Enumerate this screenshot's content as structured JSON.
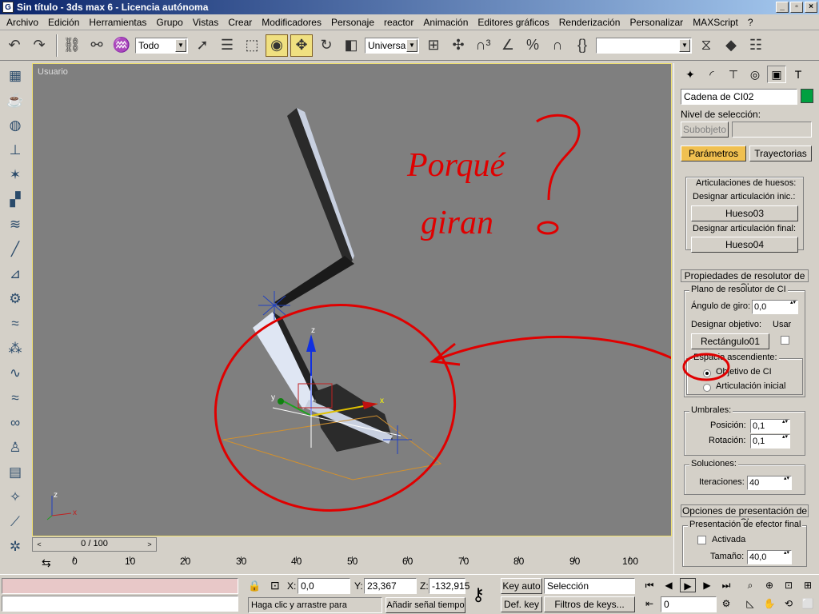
{
  "window": {
    "title": "Sin título - 3ds max 6 - Licencia autónoma",
    "app_icon": "3ds-max-icon"
  },
  "menu": [
    "Archivo",
    "Edición",
    "Herramientas",
    "Grupo",
    "Vistas",
    "Crear",
    "Modificadores",
    "Personaje",
    "reactor",
    "Animación",
    "Editores gráficos",
    "Renderización",
    "Personalizar",
    "MAXScript",
    "?"
  ],
  "toolbar": {
    "selection_filter": "Todo",
    "reference_coord": "Universal",
    "named_selection": ""
  },
  "viewport": {
    "label": "Usuario",
    "annotation_line1": "Porqué",
    "annotation_line2": "giran",
    "annotation_color": "#e00000",
    "axis_z": "z",
    "axis_x": "x",
    "axis_y": "y"
  },
  "timeline": {
    "position": "0 / 100",
    "ticks": [
      "0",
      "10",
      "20",
      "30",
      "40",
      "50",
      "60",
      "70",
      "80",
      "90",
      "100"
    ]
  },
  "panel": {
    "object_name": "Cadena de CI02",
    "object_color": "#00a040",
    "selection_level_label": "Nivel de selección:",
    "subobject_button": "Subobjeto",
    "tab_params": "Parámetros",
    "tab_trajectories": "Trayectorias",
    "bone_joints_group": "Articulaciones de huesos:",
    "assign_start_label": "Designar articulación inic.:",
    "start_bone": "Hueso03",
    "assign_end_label": "Designar articulación final:",
    "end_bone": "Hueso04",
    "ik_solver_props": "Propiedades de resolutor de CI",
    "ik_plane_group": "Plano de resolutor de CI",
    "swivel_label": "Ángulo de giro:",
    "swivel_value": "0,0",
    "assign_target_label": "Designar objetivo:",
    "use_label": "Usar",
    "target_button": "Rectángulo01",
    "parent_space_group": "Espacio ascendiente:",
    "radio_ik_goal": "Objetivo de CI",
    "radio_start_joint": "Articulación inicial",
    "thresholds_group": "Umbrales:",
    "position_label": "Posición:",
    "position_value": "0,1",
    "rotation_label": "Rotación:",
    "rotation_value": "0,1",
    "solutions_group": "Soluciones:",
    "iterations_label": "Iteraciones:",
    "iterations_value": "40",
    "display_options": "Opciones de presentación de CI",
    "effector_display_group": "Presentación de efector final",
    "activated_label": "Activada",
    "size_label": "Tamaño:",
    "size_value": "40,0"
  },
  "status": {
    "x_label": "X:",
    "x_value": "0,0",
    "y_label": "Y:",
    "y_value": "23,367",
    "z_label": "Z:",
    "z_value": "-132,915",
    "prompt": "Haga clic y arrastre para seleccion",
    "add_time_tag": "Añadir señal tiempo",
    "key_auto": "Key auto",
    "key_mode": "Selección",
    "def_key": "Def. key",
    "key_filters": "Filtros de keys...",
    "frame": "0"
  }
}
